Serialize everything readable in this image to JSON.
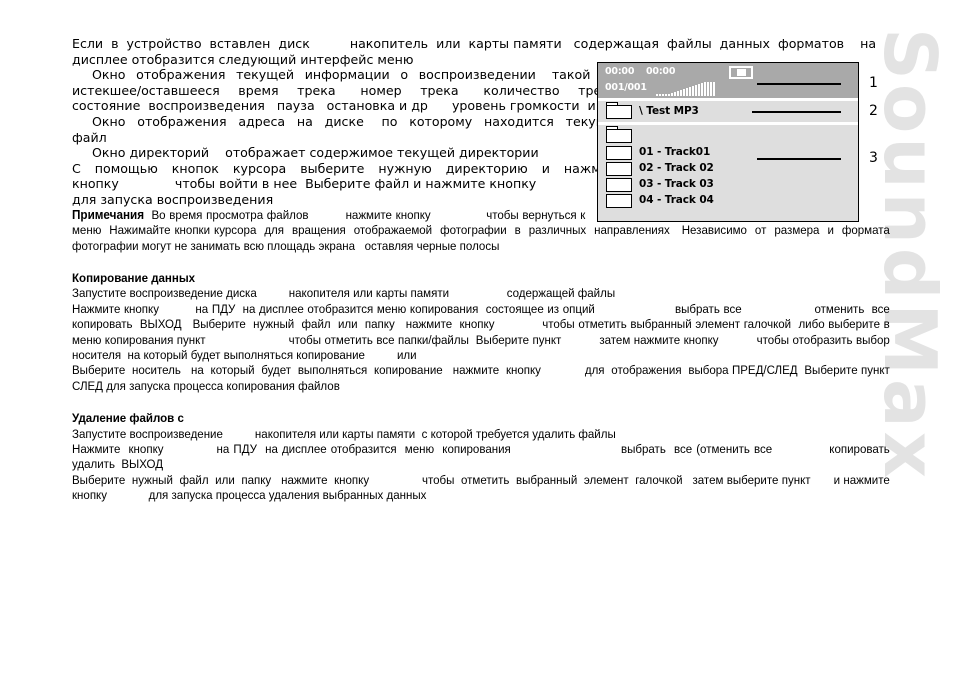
{
  "watermark": {
    "brand": "SoundMax"
  },
  "document": {
    "intro": {
      "line1": "Если  в  устройство  вставлен  диск          накопитель  или  карты памяти   содержащая  файлы  данных  форматов    на",
      "line2": "дисплее отобразится следующий интерфейс меню",
      "p_current_info": "Окно  отображения  текущей  информации  о  воспроизведении   такой  как истекшее/оставшееся   время   трека    номер   трека    количество   треков состояние  воспроизведения   пауза   остановка и др      уровень громкости  и т.д",
      "p_address": "Окно  отображения  адреса  на  диске   по  которому  находится  текущий файл",
      "p_directory": "Окно директорий    отображает содержимое текущей директории",
      "p_navigate": "С  помощью  кнопок  курсора  выберите  нужную  директорию  и  нажмите кнопку              чтобы войти в нее  Выберите файл и нажмите кнопку",
      "p_navigate_tail": "для запуска воспроизведения"
    },
    "notes": {
      "heading": "Примечания",
      "body": "  Во время просмотра файлов          нажмите кнопку               чтобы вернуться к меню  Нажимайте кнопки курсора  для  вращения  отображаемой  фотографии  в  различных  направлениях   Независимо  от  размера  и  формата фотографии могут не занимать всю площадь экрана   оставляя черные полосы"
    },
    "copy_section": {
      "heading": "Копирование данных",
      "line1": "Запустите воспроизведение диска          накопителя или карты памяти                  содержащей файлы",
      "line2": "Нажмите кнопку          на ПДУ  на дисплее отобразится меню копирования  состоящее из опций                      выбрать все                    отменить  все                копировать  ВЫХОД   Выберите  нужный  файл  или  папку   нажмите  кнопку             чтобы отметить выбранный элемент галочкой  либо выберите в меню копирования пункт                        чтобы отметить все папки/файлы  Выберите пункт           затем нажмите кнопку           чтобы отобразить выбор носителя  на который будет выполняться копирование          или",
      "line3": "Выберите  носитель   на  который  будет  выполняться  копирование   нажмите  кнопку             для  отображения  выбора ПРЕД/СЛЕД  Выберите пункт СЛЕД для запуска процесса копирования файлов"
    },
    "delete_section": {
      "heading": "Удаление файлов с",
      "line1": "Запустите воспроизведение          накопителя или карты памяти  с которой требуется удалить файлы",
      "line2": "Нажмите  кнопку             на ПДУ  на дисплее отобразится  меню  копирования                           выбрать  все (отменить все              копировать            удалить  ВЫХОД",
      "line3": "Выберите  нужный  файл  или  папку   нажмите  кнопку                чтобы  отметить  выбранный  элемент  галочкой   затем выберите пункт       и нажмите кнопку             для запуска процесса удаления выбранных данных"
    }
  },
  "device_display": {
    "status": {
      "time_elapsed": "00:00",
      "time_total": "00:00",
      "track_counter": "001/001",
      "transport_state": "stop",
      "volume_bars": [
        2,
        2,
        2,
        2,
        2,
        3,
        4,
        5,
        6,
        7,
        8,
        9,
        10,
        11,
        12,
        13,
        14,
        14,
        14,
        14
      ]
    },
    "path_row": {
      "label": "\\ Test MP3",
      "icon": "folder-icon"
    },
    "directory_rows": [
      {
        "label": "",
        "icon": "folder-icon"
      },
      {
        "label": "01 - Track01",
        "icon": "file-icon"
      },
      {
        "label": "02 - Track 02",
        "icon": "file-icon"
      },
      {
        "label": "03 - Track 03",
        "icon": "file-icon"
      },
      {
        "label": "04 - Track 04",
        "icon": "file-icon"
      }
    ]
  },
  "callouts": [
    {
      "number": "1"
    },
    {
      "number": "2"
    },
    {
      "number": "3"
    }
  ],
  "colors": {
    "status_bar": "#a9a9a9",
    "panel_body": "#dedede",
    "panel_border": "#000000",
    "watermark": "#e3e3e3",
    "page_background": "#ffffff"
  }
}
